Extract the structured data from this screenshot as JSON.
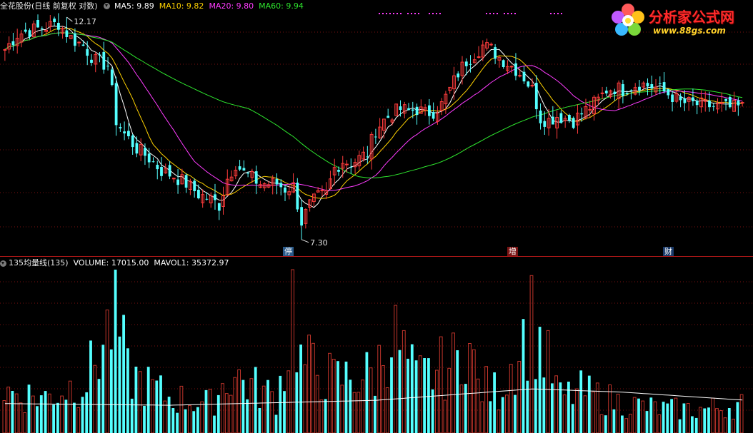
{
  "header": {
    "stock_title": "全花股份(日线 前复权 对数)",
    "ma_labels": [
      {
        "text": "MA5: 9.89",
        "color": "#ffffff"
      },
      {
        "text": "MA10: 9.82",
        "color": "#ffd200"
      },
      {
        "text": "MA20: 9.80",
        "color": "#ff3cff"
      },
      {
        "text": "MA60: 9.94",
        "color": "#2ee62e"
      }
    ]
  },
  "volume_header": {
    "indicator": "135均量线(135)",
    "volume": "VOLUME: 17015.00",
    "mavol": "MAVOL1: 35372.97"
  },
  "logo": {
    "title": "分析家公式网",
    "url": "www.88gs.com"
  },
  "event_markers": [
    {
      "label": "停",
      "bar": 72
    },
    {
      "label": "增",
      "bar": 129
    },
    {
      "label": "财",
      "bar": 168
    }
  ],
  "chart_data": [
    {
      "type": "candlestick",
      "title": "全花股份(日线 前复权 对数)",
      "log_scale": true,
      "high_annotation": "12.17",
      "low_annotation": "7.30",
      "moving_averages": [
        {
          "name": "MA5",
          "value": 9.89,
          "color": "#ffffff"
        },
        {
          "name": "MA10",
          "value": 9.82,
          "color": "#ffd200"
        },
        {
          "name": "MA20",
          "value": 9.8,
          "color": "#ff3cff"
        },
        {
          "name": "MA60",
          "value": 9.94,
          "color": "#2ee62e"
        }
      ],
      "close_path": [
        [
          0,
          11.3
        ],
        [
          3,
          11.7
        ],
        [
          6,
          11.8
        ],
        [
          10,
          11.9
        ],
        [
          13,
          12.0
        ],
        [
          16,
          11.6
        ],
        [
          19,
          11.4
        ],
        [
          22,
          11.0
        ],
        [
          25,
          10.9
        ],
        [
          27,
          9.6
        ],
        [
          29,
          9.3
        ],
        [
          32,
          9.0
        ],
        [
          35,
          8.8
        ],
        [
          38,
          8.55
        ],
        [
          41,
          8.45
        ],
        [
          44,
          8.3
        ],
        [
          47,
          8.1
        ],
        [
          50,
          8.0
        ],
        [
          52,
          7.9
        ],
        [
          54,
          8.4
        ],
        [
          56,
          8.7
        ],
        [
          58,
          8.5
        ],
        [
          60,
          8.4
        ],
        [
          62,
          8.3
        ],
        [
          64,
          8.3
        ],
        [
          66,
          8.3
        ],
        [
          68,
          8.2
        ],
        [
          70,
          8.25
        ],
        [
          72,
          7.6
        ],
        [
          74,
          7.9
        ],
        [
          76,
          8.05
        ],
        [
          78,
          8.1
        ],
        [
          80,
          8.6
        ],
        [
          82,
          8.75
        ],
        [
          84,
          8.7
        ],
        [
          86,
          8.8
        ],
        [
          88,
          8.9
        ],
        [
          90,
          9.4
        ],
        [
          92,
          9.6
        ],
        [
          94,
          9.75
        ],
        [
          96,
          9.85
        ],
        [
          98,
          9.8
        ],
        [
          100,
          9.85
        ],
        [
          102,
          9.75
        ],
        [
          104,
          9.8
        ],
        [
          106,
          9.95
        ],
        [
          108,
          10.3
        ],
        [
          110,
          10.7
        ],
        [
          112,
          11.0
        ],
        [
          114,
          11.2
        ],
        [
          116,
          11.4
        ],
        [
          118,
          11.3
        ],
        [
          120,
          11.1
        ],
        [
          122,
          10.95
        ],
        [
          124,
          10.8
        ],
        [
          126,
          10.6
        ],
        [
          128,
          10.3
        ],
        [
          130,
          9.65
        ],
        [
          132,
          9.6
        ],
        [
          134,
          9.7
        ],
        [
          136,
          9.65
        ],
        [
          138,
          9.6
        ],
        [
          140,
          9.75
        ],
        [
          142,
          9.9
        ],
        [
          144,
          10.05
        ],
        [
          146,
          10.3
        ],
        [
          148,
          10.35
        ],
        [
          150,
          10.3
        ],
        [
          152,
          10.4
        ],
        [
          154,
          10.45
        ],
        [
          156,
          10.4
        ],
        [
          158,
          10.35
        ],
        [
          160,
          10.25
        ],
        [
          162,
          10.15
        ],
        [
          164,
          10.0
        ],
        [
          166,
          9.98
        ],
        [
          168,
          9.96
        ],
        [
          170,
          9.93
        ],
        [
          172,
          9.92
        ],
        [
          174,
          9.9
        ],
        [
          176,
          9.88
        ],
        [
          178,
          9.89
        ]
      ],
      "high": 12.17,
      "low": 7.3,
      "bars": 180
    },
    {
      "type": "bar",
      "title": "135均量线(135)",
      "series": [
        {
          "name": "VOLUME",
          "last": 17015.0
        },
        {
          "name": "MAVOL1",
          "last": 35372.97
        }
      ],
      "volume_profile": [
        [
          0,
          0.35
        ],
        [
          10,
          0.3
        ],
        [
          20,
          0.45
        ],
        [
          27,
          1.0
        ],
        [
          30,
          0.5
        ],
        [
          40,
          0.3
        ],
        [
          50,
          0.25
        ],
        [
          55,
          0.5
        ],
        [
          60,
          0.4
        ],
        [
          66,
          0.3
        ],
        [
          69,
          0.7
        ],
        [
          70,
          1.1
        ],
        [
          72,
          0.6
        ],
        [
          80,
          0.45
        ],
        [
          90,
          0.5
        ],
        [
          94,
          0.85
        ],
        [
          100,
          0.45
        ],
        [
          110,
          0.6
        ],
        [
          112,
          0.85
        ],
        [
          115,
          0.4
        ],
        [
          120,
          0.35
        ],
        [
          128,
          0.95
        ],
        [
          135,
          0.3
        ],
        [
          140,
          0.35
        ],
        [
          150,
          0.25
        ],
        [
          160,
          0.2
        ],
        [
          170,
          0.2
        ],
        [
          180,
          0.25
        ]
      ],
      "mavol_profile": [
        [
          0,
          0.18
        ],
        [
          40,
          0.17
        ],
        [
          90,
          0.2
        ],
        [
          128,
          0.27
        ],
        [
          150,
          0.25
        ],
        [
          180,
          0.2
        ]
      ],
      "y_max": 230000
    }
  ]
}
